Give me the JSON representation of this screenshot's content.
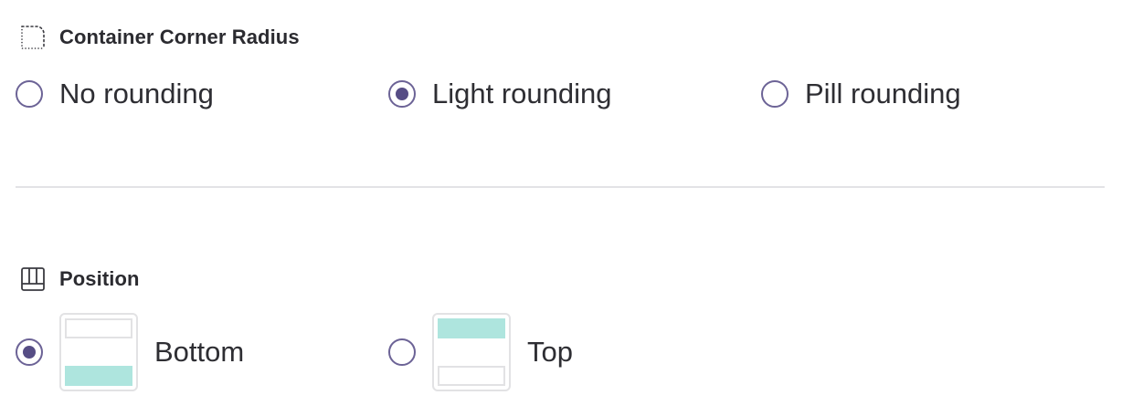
{
  "corner_radius": {
    "title": "Container Corner Radius",
    "icon": "dotted-corner-icon",
    "selected": "light",
    "options": [
      {
        "key": "none",
        "label": "No rounding",
        "checked": false
      },
      {
        "key": "light",
        "label": "Light rounding",
        "checked": true
      },
      {
        "key": "pill",
        "label": "Pill rounding",
        "checked": false
      }
    ]
  },
  "position": {
    "title": "Position",
    "icon": "layout-panel-icon",
    "selected": "bottom",
    "options": [
      {
        "key": "bottom",
        "label": "Bottom",
        "checked": true
      },
      {
        "key": "top",
        "label": "Top",
        "checked": false
      }
    ]
  },
  "colors": {
    "radio_accent": "#564d85",
    "radio_border": "#6c6396",
    "preview_fill": "#aee5de",
    "preview_border": "#e2e2e4",
    "divider": "#e3e3e6"
  }
}
